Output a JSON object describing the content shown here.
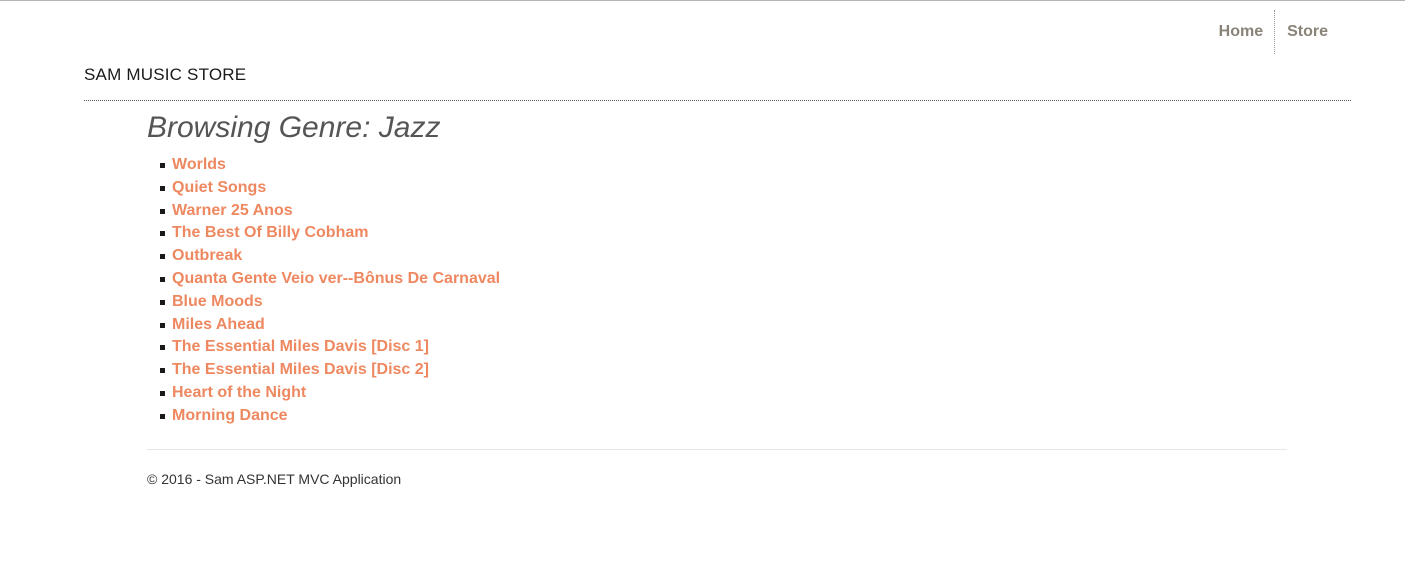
{
  "nav": {
    "home_label": "Home",
    "store_label": "Store"
  },
  "brand": "SAM MUSIC STORE",
  "page_title": "Browsing Genre: Jazz",
  "albums": [
    "Worlds",
    "Quiet Songs",
    "Warner 25 Anos",
    "The Best Of Billy Cobham",
    "Outbreak",
    "Quanta Gente Veio ver--Bônus De Carnaval",
    "Blue Moods",
    "Miles Ahead",
    "The Essential Miles Davis [Disc 1]",
    "The Essential Miles Davis [Disc 2]",
    "Heart of the Night",
    "Morning Dance"
  ],
  "footer": "© 2016 - Sam ASP.NET MVC Application",
  "colors": {
    "link": "#ee8860",
    "nav": "#8a8478",
    "title": "#555555"
  }
}
